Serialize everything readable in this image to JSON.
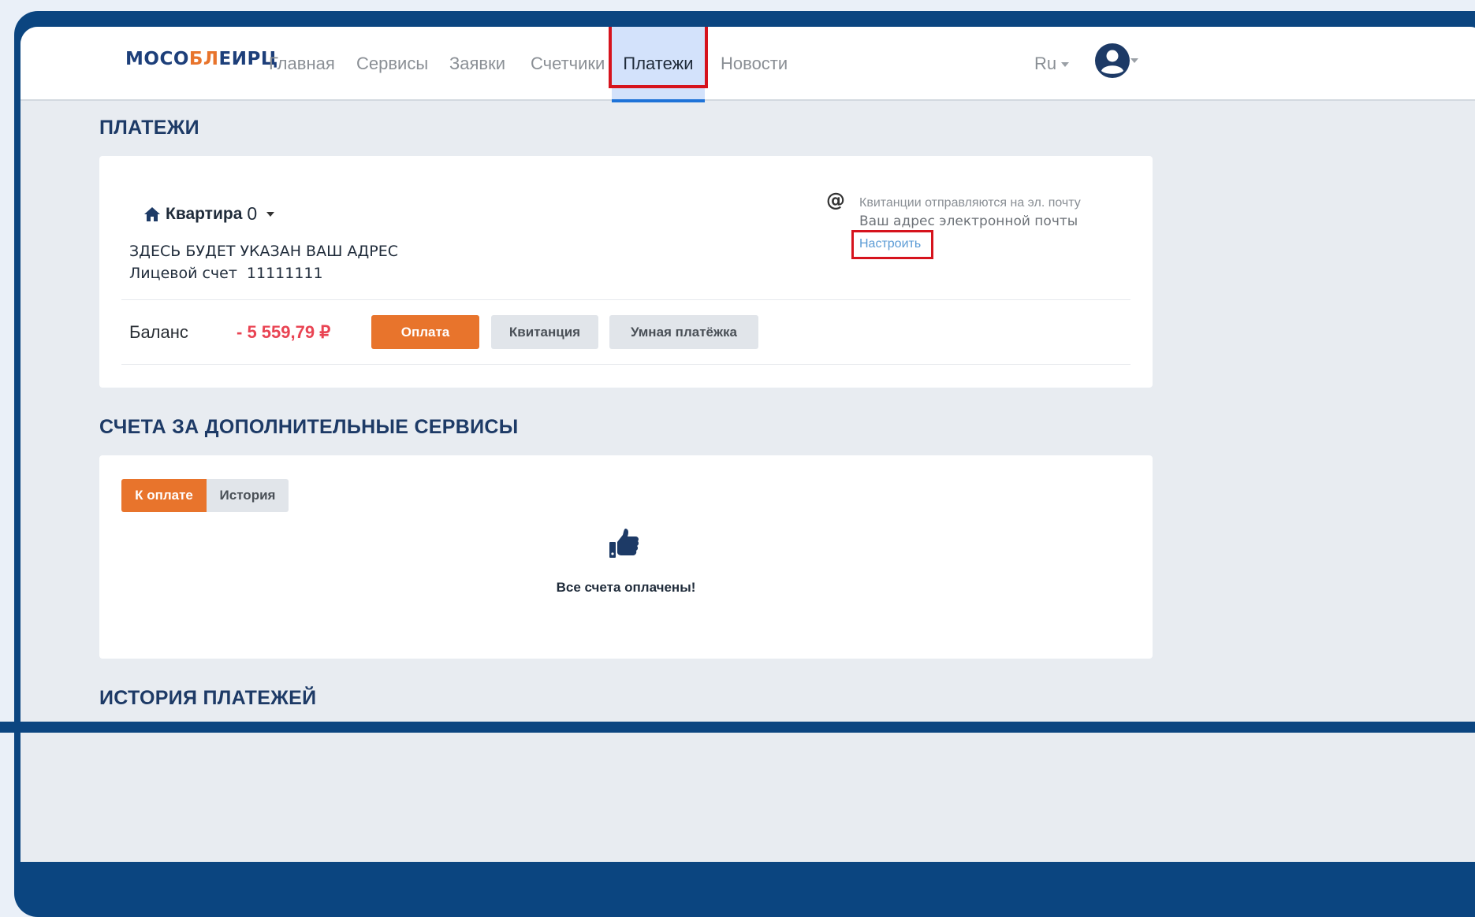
{
  "header": {
    "logo": {
      "part1": "МОСО",
      "part2": "БЛ",
      "part3": "ЕИРЦ"
    },
    "nav": [
      {
        "label": "Главная"
      },
      {
        "label": "Сервисы"
      },
      {
        "label": "Заявки"
      },
      {
        "label": "Счетчики"
      },
      {
        "label": "Платежи",
        "active": true
      },
      {
        "label": "Новости"
      }
    ],
    "language": "Ru",
    "avatar_icon": "user-circle-icon"
  },
  "payments": {
    "title": "ПЛАТЕЖИ",
    "apartment_label": "Квартира",
    "apartment_number": "0",
    "address": "ЗДЕСЬ БУДЕТ УКАЗАН ВАШ АДРЕС",
    "account_label": "Лицевой счет",
    "account_number": "11111111",
    "email_notice": "Квитанции отправляются на эл. почту",
    "email_address": "Ваш адрес электронной почты",
    "email_setup": "Настроить",
    "balance_label": "Баланс",
    "balance_value": "- 5 559,79 ₽",
    "buttons": {
      "pay": "Оплата",
      "receipt": "Квитанция",
      "smart": "Умная платёжка"
    }
  },
  "services": {
    "title": "СЧЕТА ЗА ДОПОЛНИТЕЛЬНЫЕ СЕРВИСЫ",
    "tabs": {
      "to_pay": "К оплате",
      "history": "История"
    },
    "message": "Все счета оплачены!"
  },
  "history": {
    "title": "ИСТОРИЯ ПЛАТЕЖЕЙ"
  },
  "colors": {
    "accent_orange": "#e8742c",
    "brand_blue": "#1d3f7a",
    "negative_red": "#e94453",
    "highlight_red": "#d6131d"
  }
}
